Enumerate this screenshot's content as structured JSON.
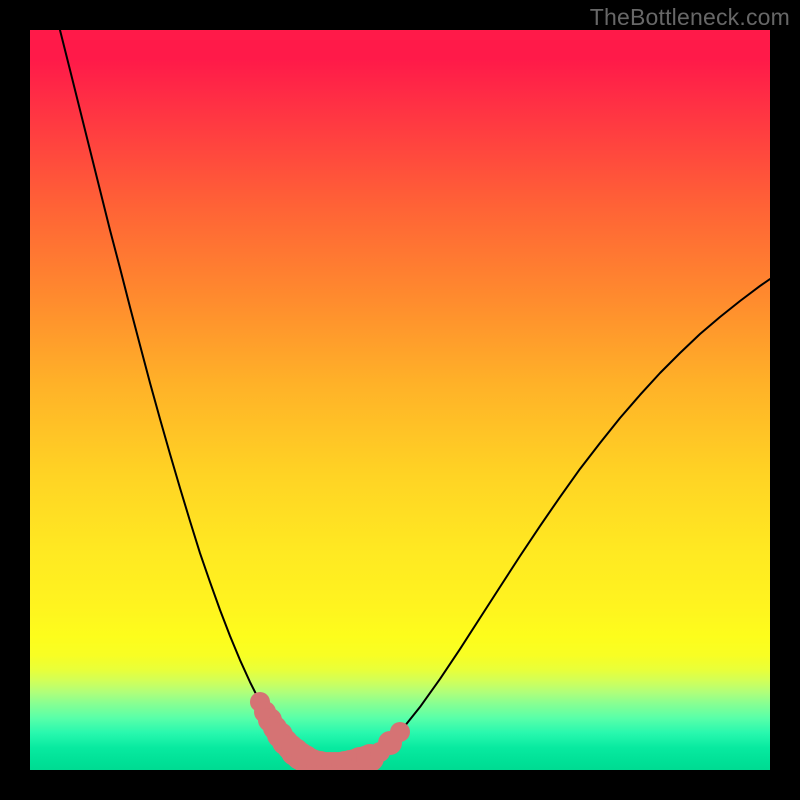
{
  "watermark": "TheBottleneck.com",
  "chart_data": {
    "type": "line",
    "title": "",
    "xlabel": "",
    "ylabel": "",
    "xlim": [
      0,
      100
    ],
    "ylim": [
      0,
      100
    ],
    "grid": false,
    "legend": false,
    "series": [
      {
        "name": "left-arm",
        "color": "#000000",
        "stroke_width": 2,
        "x": [
          4.05,
          5.41,
          6.76,
          8.11,
          9.46,
          10.81,
          12.16,
          13.51,
          14.86,
          16.22,
          17.57,
          18.92,
          20.27,
          21.62,
          22.97,
          24.32,
          25.68,
          27.03,
          28.38,
          29.73,
          31.08,
          32.43,
          33.78,
          35.14,
          36.49,
          37.16
        ],
        "values": [
          100.0,
          94.59,
          89.19,
          83.78,
          78.38,
          72.97,
          67.84,
          62.57,
          57.43,
          52.3,
          47.43,
          42.7,
          38.11,
          33.65,
          29.32,
          25.41,
          21.62,
          18.11,
          14.86,
          11.89,
          9.19,
          6.76,
          4.73,
          3.11,
          1.89,
          1.49
        ]
      },
      {
        "name": "right-arm",
        "color": "#000000",
        "stroke_width": 2,
        "x": [
          45.95,
          47.3,
          48.65,
          50.0,
          52.7,
          55.41,
          58.11,
          60.81,
          63.51,
          66.22,
          68.92,
          71.62,
          74.32,
          77.03,
          79.73,
          82.43,
          85.14,
          87.84,
          90.54,
          93.24,
          95.95,
          98.65,
          100.0
        ],
        "values": [
          1.62,
          2.43,
          3.65,
          5.14,
          8.51,
          12.3,
          16.35,
          20.54,
          24.73,
          28.92,
          32.97,
          36.89,
          40.68,
          44.19,
          47.57,
          50.68,
          53.65,
          56.35,
          58.92,
          61.22,
          63.38,
          65.41,
          66.35
        ]
      },
      {
        "name": "marker-band",
        "type": "markers",
        "color": "#d57374",
        "x": [
          31.08,
          31.76,
          32.43,
          33.11,
          33.78,
          34.46,
          35.14,
          35.81,
          36.49,
          37.16,
          37.84,
          38.51,
          39.19,
          39.86,
          40.54,
          41.22,
          41.89,
          42.57,
          43.24,
          43.92,
          44.59,
          45.27,
          45.95,
          47.3,
          48.65,
          50.0
        ],
        "values": [
          9.19,
          7.84,
          6.76,
          5.68,
          4.73,
          3.78,
          3.11,
          2.43,
          1.89,
          1.49,
          1.08,
          0.81,
          0.68,
          0.54,
          0.54,
          0.54,
          0.54,
          0.68,
          0.81,
          0.95,
          1.22,
          1.35,
          1.62,
          2.43,
          3.65,
          5.14
        ],
        "sizes": [
          10,
          11,
          12,
          12,
          13,
          13,
          13,
          14,
          14,
          14,
          14,
          14,
          14,
          14,
          14,
          14,
          14,
          14,
          14,
          14,
          14,
          14,
          14,
          10,
          12,
          10
        ]
      }
    ]
  }
}
